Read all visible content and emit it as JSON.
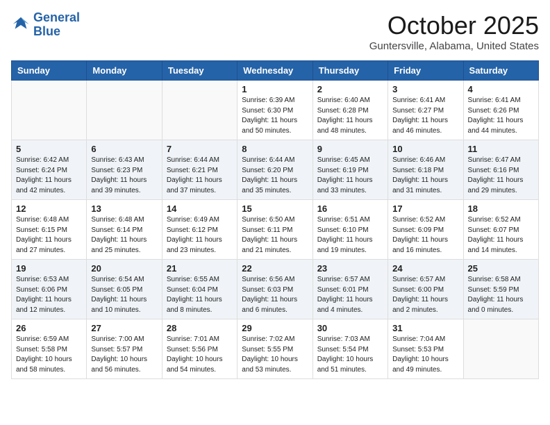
{
  "header": {
    "logo_line1": "General",
    "logo_line2": "Blue",
    "month": "October 2025",
    "location": "Guntersville, Alabama, United States"
  },
  "days_of_week": [
    "Sunday",
    "Monday",
    "Tuesday",
    "Wednesday",
    "Thursday",
    "Friday",
    "Saturday"
  ],
  "weeks": [
    [
      {
        "day": "",
        "info": ""
      },
      {
        "day": "",
        "info": ""
      },
      {
        "day": "",
        "info": ""
      },
      {
        "day": "1",
        "info": "Sunrise: 6:39 AM\nSunset: 6:30 PM\nDaylight: 11 hours\nand 50 minutes."
      },
      {
        "day": "2",
        "info": "Sunrise: 6:40 AM\nSunset: 6:28 PM\nDaylight: 11 hours\nand 48 minutes."
      },
      {
        "day": "3",
        "info": "Sunrise: 6:41 AM\nSunset: 6:27 PM\nDaylight: 11 hours\nand 46 minutes."
      },
      {
        "day": "4",
        "info": "Sunrise: 6:41 AM\nSunset: 6:26 PM\nDaylight: 11 hours\nand 44 minutes."
      }
    ],
    [
      {
        "day": "5",
        "info": "Sunrise: 6:42 AM\nSunset: 6:24 PM\nDaylight: 11 hours\nand 42 minutes."
      },
      {
        "day": "6",
        "info": "Sunrise: 6:43 AM\nSunset: 6:23 PM\nDaylight: 11 hours\nand 39 minutes."
      },
      {
        "day": "7",
        "info": "Sunrise: 6:44 AM\nSunset: 6:21 PM\nDaylight: 11 hours\nand 37 minutes."
      },
      {
        "day": "8",
        "info": "Sunrise: 6:44 AM\nSunset: 6:20 PM\nDaylight: 11 hours\nand 35 minutes."
      },
      {
        "day": "9",
        "info": "Sunrise: 6:45 AM\nSunset: 6:19 PM\nDaylight: 11 hours\nand 33 minutes."
      },
      {
        "day": "10",
        "info": "Sunrise: 6:46 AM\nSunset: 6:18 PM\nDaylight: 11 hours\nand 31 minutes."
      },
      {
        "day": "11",
        "info": "Sunrise: 6:47 AM\nSunset: 6:16 PM\nDaylight: 11 hours\nand 29 minutes."
      }
    ],
    [
      {
        "day": "12",
        "info": "Sunrise: 6:48 AM\nSunset: 6:15 PM\nDaylight: 11 hours\nand 27 minutes."
      },
      {
        "day": "13",
        "info": "Sunrise: 6:48 AM\nSunset: 6:14 PM\nDaylight: 11 hours\nand 25 minutes."
      },
      {
        "day": "14",
        "info": "Sunrise: 6:49 AM\nSunset: 6:12 PM\nDaylight: 11 hours\nand 23 minutes."
      },
      {
        "day": "15",
        "info": "Sunrise: 6:50 AM\nSunset: 6:11 PM\nDaylight: 11 hours\nand 21 minutes."
      },
      {
        "day": "16",
        "info": "Sunrise: 6:51 AM\nSunset: 6:10 PM\nDaylight: 11 hours\nand 19 minutes."
      },
      {
        "day": "17",
        "info": "Sunrise: 6:52 AM\nSunset: 6:09 PM\nDaylight: 11 hours\nand 16 minutes."
      },
      {
        "day": "18",
        "info": "Sunrise: 6:52 AM\nSunset: 6:07 PM\nDaylight: 11 hours\nand 14 minutes."
      }
    ],
    [
      {
        "day": "19",
        "info": "Sunrise: 6:53 AM\nSunset: 6:06 PM\nDaylight: 11 hours\nand 12 minutes."
      },
      {
        "day": "20",
        "info": "Sunrise: 6:54 AM\nSunset: 6:05 PM\nDaylight: 11 hours\nand 10 minutes."
      },
      {
        "day": "21",
        "info": "Sunrise: 6:55 AM\nSunset: 6:04 PM\nDaylight: 11 hours\nand 8 minutes."
      },
      {
        "day": "22",
        "info": "Sunrise: 6:56 AM\nSunset: 6:03 PM\nDaylight: 11 hours\nand 6 minutes."
      },
      {
        "day": "23",
        "info": "Sunrise: 6:57 AM\nSunset: 6:01 PM\nDaylight: 11 hours\nand 4 minutes."
      },
      {
        "day": "24",
        "info": "Sunrise: 6:57 AM\nSunset: 6:00 PM\nDaylight: 11 hours\nand 2 minutes."
      },
      {
        "day": "25",
        "info": "Sunrise: 6:58 AM\nSunset: 5:59 PM\nDaylight: 11 hours\nand 0 minutes."
      }
    ],
    [
      {
        "day": "26",
        "info": "Sunrise: 6:59 AM\nSunset: 5:58 PM\nDaylight: 10 hours\nand 58 minutes."
      },
      {
        "day": "27",
        "info": "Sunrise: 7:00 AM\nSunset: 5:57 PM\nDaylight: 10 hours\nand 56 minutes."
      },
      {
        "day": "28",
        "info": "Sunrise: 7:01 AM\nSunset: 5:56 PM\nDaylight: 10 hours\nand 54 minutes."
      },
      {
        "day": "29",
        "info": "Sunrise: 7:02 AM\nSunset: 5:55 PM\nDaylight: 10 hours\nand 53 minutes."
      },
      {
        "day": "30",
        "info": "Sunrise: 7:03 AM\nSunset: 5:54 PM\nDaylight: 10 hours\nand 51 minutes."
      },
      {
        "day": "31",
        "info": "Sunrise: 7:04 AM\nSunset: 5:53 PM\nDaylight: 10 hours\nand 49 minutes."
      },
      {
        "day": "",
        "info": ""
      }
    ]
  ]
}
